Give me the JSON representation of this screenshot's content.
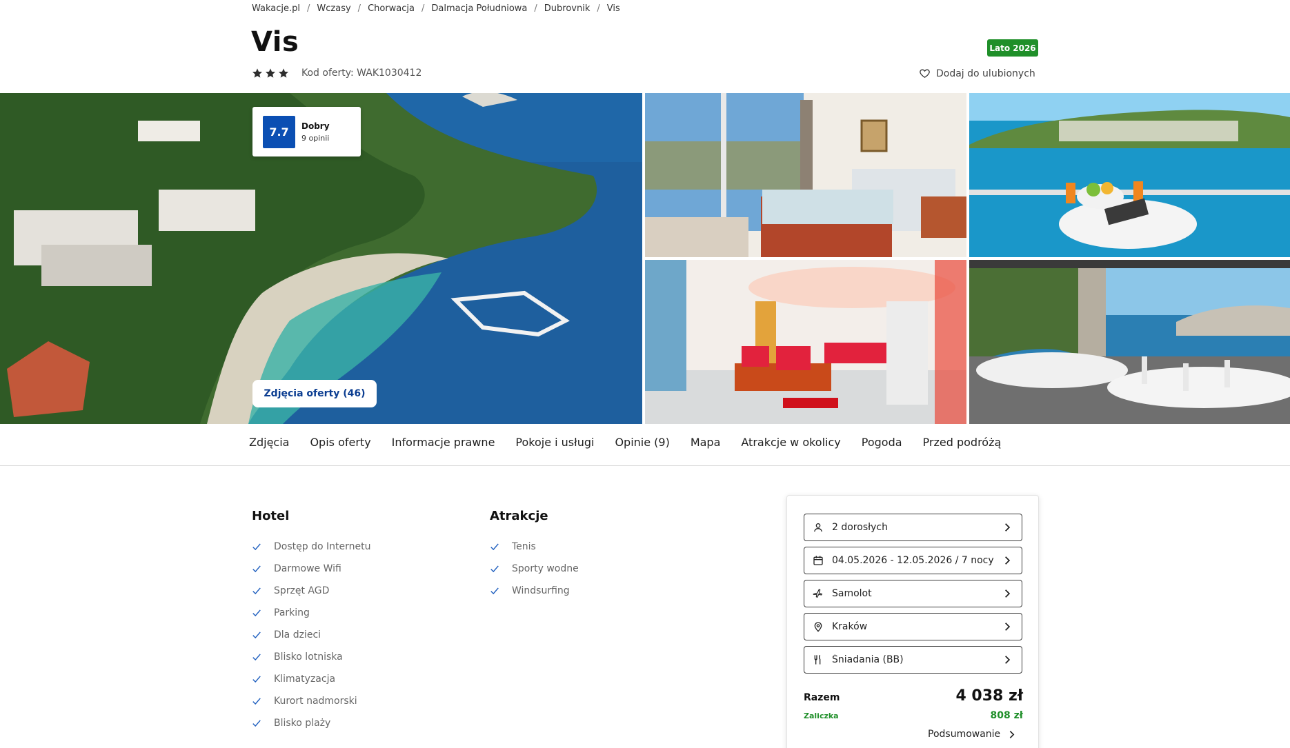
{
  "breadcrumb": [
    "Wakacje.pl",
    "Wczasy",
    "Chorwacja",
    "Dalmacja Południowa",
    "Dubrovnik",
    "Vis"
  ],
  "hotel": {
    "name": "Vis",
    "stars": 3,
    "offer_code": "Kod oferty: WAK1030412",
    "season_badge": "Lato 2026",
    "favorite_label": "Dodaj do ulubionych"
  },
  "rating": {
    "score": "7.7",
    "label": "Dobry",
    "count": "9 opinii"
  },
  "gallery": {
    "photos_button": "Zdjęcia oferty (46)"
  },
  "tabs": [
    "Zdjęcia",
    "Opis oferty",
    "Informacje prawne",
    "Pokoje i usługi",
    "Opinie (9)",
    "Mapa",
    "Atrakcje w okolicy",
    "Pogoda",
    "Przed podróżą"
  ],
  "amenities": {
    "hotel": {
      "title": "Hotel",
      "items": [
        "Dostęp do Internetu",
        "Darmowe Wifi",
        "Sprzęt AGD",
        "Parking",
        "Dla dzieci",
        "Blisko lotniska",
        "Klimatyzacja",
        "Kurort nadmorski",
        "Blisko plaży"
      ]
    },
    "attractions": {
      "title": "Atrakcje",
      "items": [
        "Tenis",
        "Sporty wodne",
        "Windsurfing"
      ]
    }
  },
  "booking": {
    "travelers": "2 dorosłych",
    "dates": "04.05.2026 - 12.05.2026 / 7 nocy",
    "transport": "Samolot",
    "departure": "Kraków",
    "board": "Śniadania (BB)",
    "total_label": "Razem",
    "total_value": "4 038 zł",
    "deposit_label": "Zaliczka",
    "deposit_value": "808 zł",
    "summary_label": "Podsumowanie"
  },
  "colors": {
    "accent_blue": "#0b4fb3",
    "badge_green": "#1f8f29",
    "check_blue": "#1f5fbf"
  }
}
